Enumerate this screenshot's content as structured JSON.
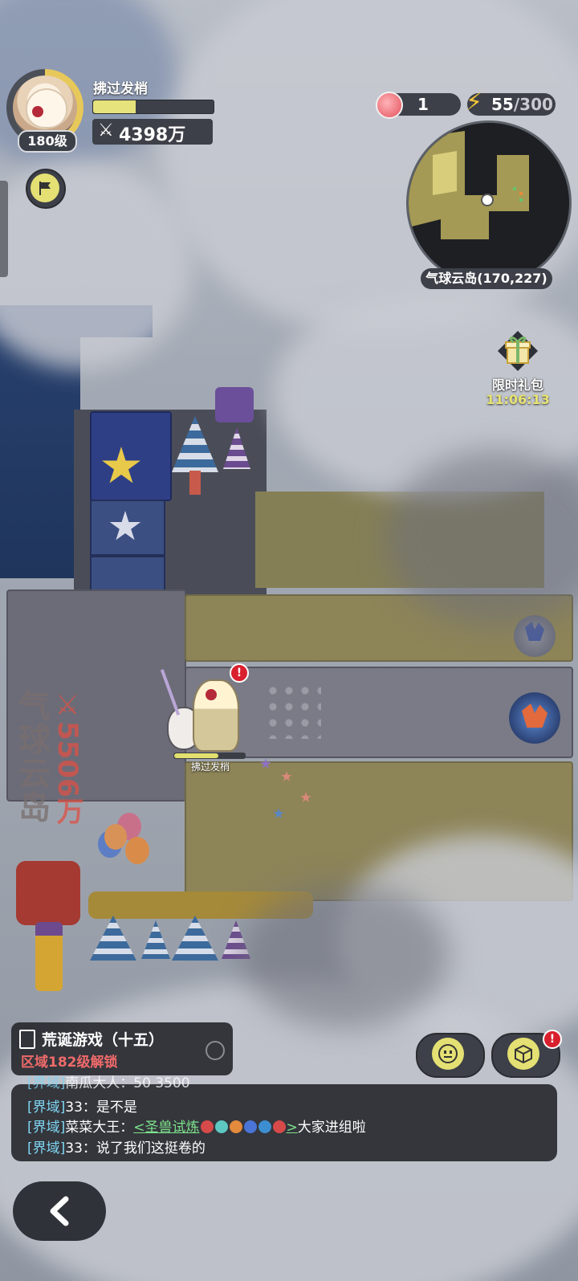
{
  "player": {
    "name": "拂过发梢",
    "level_label": "180级",
    "power_icon": "crossed-swords-icon",
    "power": "4398万",
    "xp_progress": 0.36
  },
  "resources": {
    "peach_icon": "peach-icon",
    "peach_count": "1",
    "energy_icon": "lightning-icon",
    "energy_current": "55",
    "energy_max": "/300"
  },
  "minimap": {
    "location": "气球云岛(170,227)"
  },
  "gift": {
    "label": "限时礼包",
    "timer": "11:06:13"
  },
  "world": {
    "zone_name": "气球云岛",
    "zone_power_icon": "crossed-swords-icon",
    "zone_power": "5506万",
    "player_label": "拂过发梢",
    "player_hp": 0.62
  },
  "quest": {
    "icon": "clipboard-icon",
    "title": "荒诞游戏（十五）",
    "requirement": "区域182级解锁"
  },
  "chat": {
    "messages": [
      {
        "channel": "[界域]",
        "text": "南瓜大人：50 3500"
      },
      {
        "channel": "[界域]",
        "text": "33：是不是"
      },
      {
        "channel": "[界域]",
        "sender": "菜菜大王：",
        "link": "<圣兽试炼",
        "link_end": ">",
        "text": "大家进组啦"
      },
      {
        "channel": "[界域]",
        "text": "33：说了我们这挺卷的"
      }
    ]
  },
  "buttons": {
    "emote_icon": "face-icon",
    "inventory_icon": "cube-icon",
    "back_icon": "chevron-left-icon"
  },
  "colors": {
    "accent_yellow": "#e4e073",
    "alert_red": "#d9202e",
    "chat_channel": "#7fd5f2",
    "chat_link": "#7ee38c",
    "warning_red": "#ef6a6a"
  }
}
